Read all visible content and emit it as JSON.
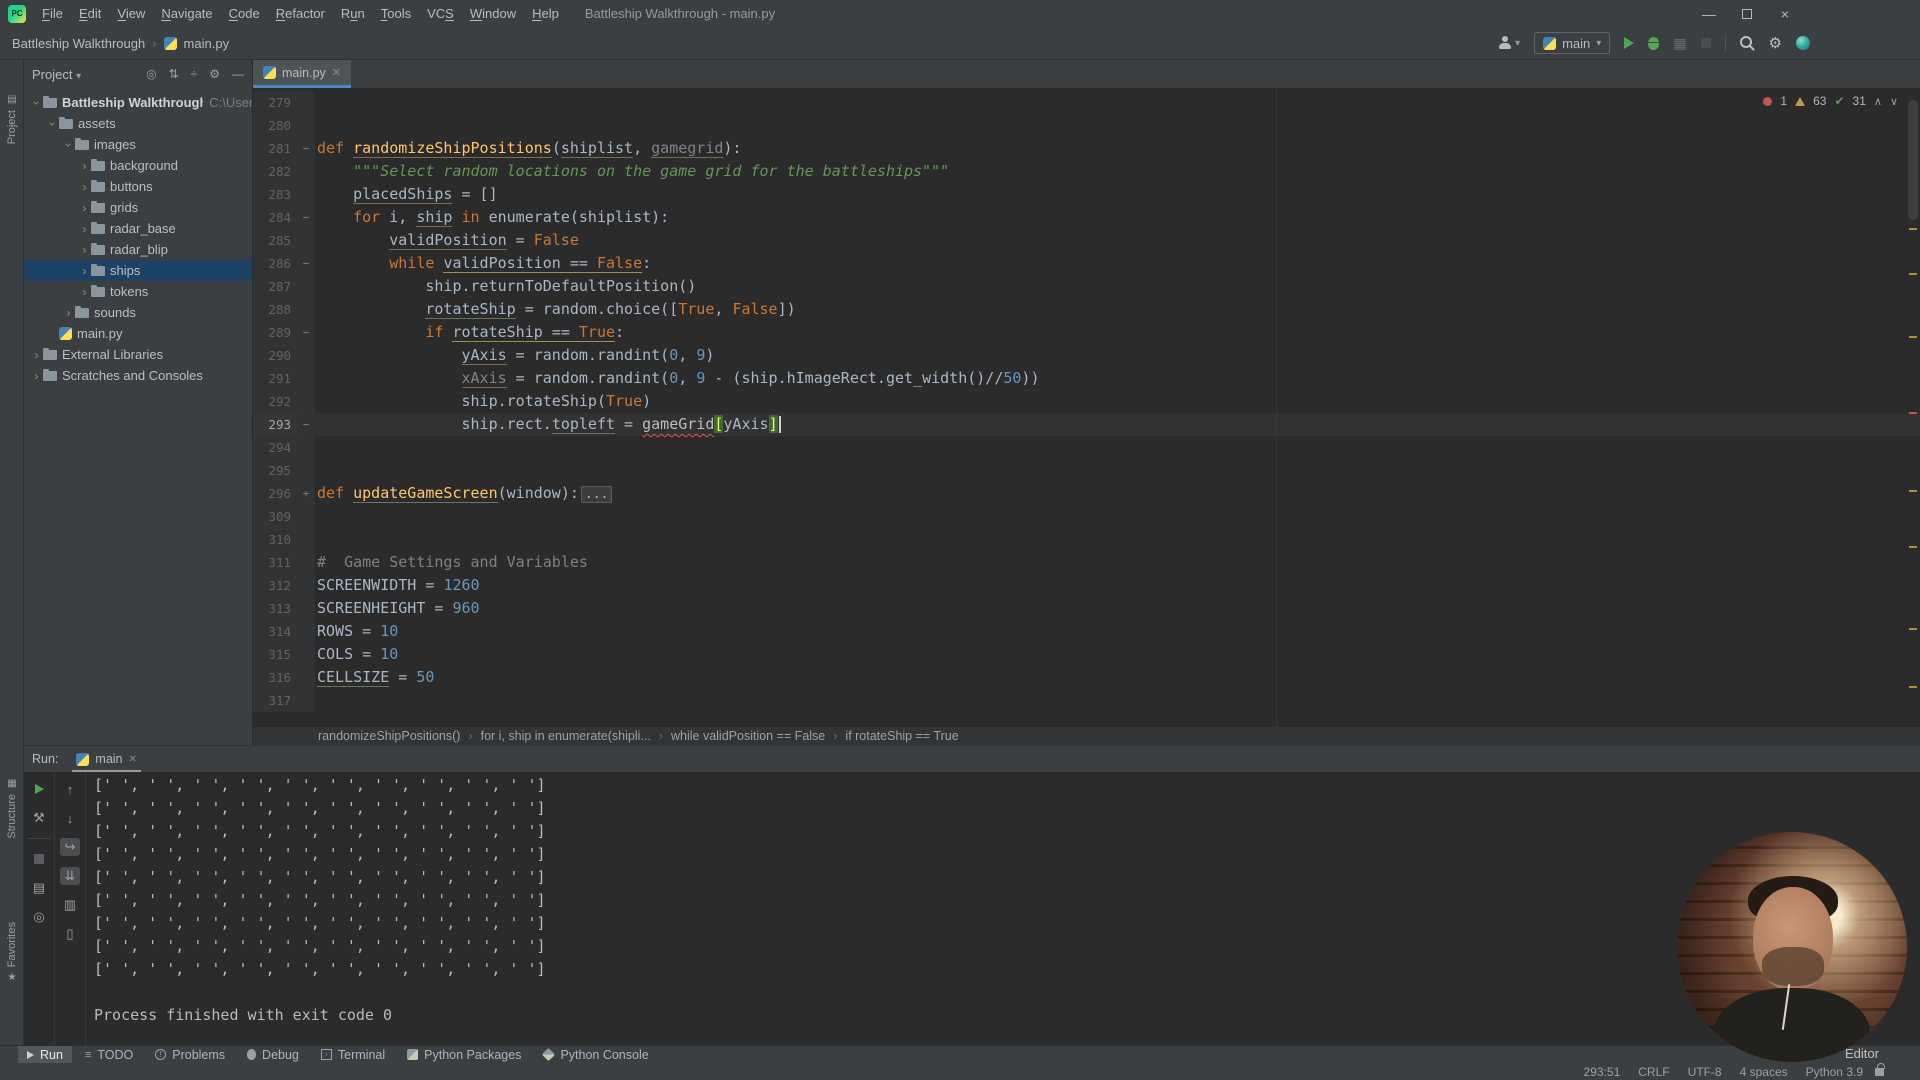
{
  "colors": {
    "accent_blue": "#4a88c7",
    "run_green": "#4fa84f",
    "error_red": "#c75450",
    "warning_yellow": "#b5a04c",
    "selection_blue": "#1d4266"
  },
  "title_bar": {
    "app_icon": "PC",
    "menus": [
      {
        "label": "File",
        "m": 0
      },
      {
        "label": "Edit",
        "m": 0
      },
      {
        "label": "View",
        "m": 0
      },
      {
        "label": "Navigate",
        "m": 0
      },
      {
        "label": "Code",
        "m": 0
      },
      {
        "label": "Refactor",
        "m": 0
      },
      {
        "label": "Run",
        "m": 1
      },
      {
        "label": "Tools",
        "m": 0
      },
      {
        "label": "VCS",
        "m": 2
      },
      {
        "label": "Window",
        "m": 0
      },
      {
        "label": "Help",
        "m": 0
      }
    ],
    "window_title": "Battleship Walkthrough - main.py"
  },
  "nav_bar": {
    "breadcrumbs": [
      "Battleship Walkthrough",
      "main.py"
    ],
    "run_config": "main"
  },
  "tool_strip": {
    "project": "Project",
    "structure": "Structure",
    "favorites": "Favorites"
  },
  "project_panel": {
    "title": "Project",
    "header_icons": [
      "locate-icon",
      "expand-collapse-icon",
      "collapse-all-icon",
      "settings-icon",
      "hide-icon"
    ],
    "tree": [
      {
        "label": "Battleship Walkthrough",
        "suffix": "C:\\User",
        "indent": 0,
        "chev": "open",
        "icon": "folder",
        "bold": true
      },
      {
        "label": "assets",
        "indent": 1,
        "chev": "open",
        "icon": "folder"
      },
      {
        "label": "images",
        "indent": 2,
        "chev": "open",
        "icon": "folder"
      },
      {
        "label": "background",
        "indent": 3,
        "chev": "closed",
        "icon": "folder"
      },
      {
        "label": "buttons",
        "indent": 3,
        "chev": "closed",
        "icon": "folder"
      },
      {
        "label": "grids",
        "indent": 3,
        "chev": "closed",
        "icon": "folder"
      },
      {
        "label": "radar_base",
        "indent": 3,
        "chev": "closed",
        "icon": "folder"
      },
      {
        "label": "radar_blip",
        "indent": 3,
        "chev": "closed",
        "icon": "folder"
      },
      {
        "label": "ships",
        "indent": 3,
        "chev": "closed",
        "icon": "folder",
        "sel": true
      },
      {
        "label": "tokens",
        "indent": 3,
        "chev": "closed",
        "icon": "folder"
      },
      {
        "label": "sounds",
        "indent": 2,
        "chev": "closed",
        "icon": "folder"
      },
      {
        "label": "main.py",
        "indent": 1,
        "chev": "none",
        "icon": "py"
      },
      {
        "label": "External Libraries",
        "indent": 0,
        "chev": "closed",
        "icon": "folder"
      },
      {
        "label": "Scratches and Consoles",
        "indent": 0,
        "chev": "closed",
        "icon": "folder"
      }
    ]
  },
  "editor": {
    "tab": "main.py",
    "inspections": {
      "errors": "1",
      "warnings": "63",
      "passed": "31"
    },
    "lines": [
      {
        "n": "279",
        "t": []
      },
      {
        "n": "280",
        "t": []
      },
      {
        "n": "281",
        "f": "m",
        "t": [
          [
            "k",
            "def "
          ],
          [
            "f u",
            "randomizeShipPositions"
          ],
          [
            "p",
            "("
          ],
          [
            "p u",
            "shiplist"
          ],
          [
            "p",
            ", "
          ],
          [
            "g u",
            "gamegrid"
          ],
          [
            "p",
            "):"
          ]
        ]
      },
      {
        "n": "282",
        "t": [
          [
            "s",
            "    \"\"\"Select random locations on the game grid for the battleships\"\"\""
          ]
        ]
      },
      {
        "n": "283",
        "t": [
          [
            "p",
            "    "
          ],
          [
            "p u",
            "placedShips"
          ],
          [
            "p",
            " = []"
          ]
        ]
      },
      {
        "n": "284",
        "f": "m",
        "t": [
          [
            "p",
            "    "
          ],
          [
            "k",
            "for"
          ],
          [
            "p",
            " i, "
          ],
          [
            "p u",
            "ship"
          ],
          [
            "p",
            " "
          ],
          [
            "k",
            "in"
          ],
          [
            "p",
            " enumerate(shiplist):"
          ]
        ]
      },
      {
        "n": "285",
        "t": [
          [
            "p",
            "        "
          ],
          [
            "p u",
            "validPosition"
          ],
          [
            "p",
            " = "
          ],
          [
            "k",
            "False"
          ]
        ]
      },
      {
        "n": "286",
        "f": "m",
        "t": [
          [
            "p",
            "        "
          ],
          [
            "k",
            "while"
          ],
          [
            "p",
            " "
          ],
          [
            "p w",
            "validPosition == "
          ],
          [
            "k w",
            "False"
          ],
          [
            "p",
            ":"
          ]
        ]
      },
      {
        "n": "287",
        "t": [
          [
            "p",
            "            ship.returnToDefaultPosition()"
          ]
        ]
      },
      {
        "n": "288",
        "t": [
          [
            "p",
            "            "
          ],
          [
            "p u",
            "rotateShip"
          ],
          [
            "p",
            " = random.choice(["
          ],
          [
            "k",
            "True"
          ],
          [
            "p",
            ", "
          ],
          [
            "k",
            "False"
          ],
          [
            "p",
            "])"
          ]
        ]
      },
      {
        "n": "289",
        "f": "m",
        "t": [
          [
            "p",
            "            "
          ],
          [
            "k",
            "if"
          ],
          [
            "p",
            " "
          ],
          [
            "p w",
            "rotateShip == "
          ],
          [
            "k w",
            "True"
          ],
          [
            "p",
            ":"
          ]
        ]
      },
      {
        "n": "290",
        "t": [
          [
            "p",
            "                "
          ],
          [
            "p u",
            "yAxis"
          ],
          [
            "p",
            " = random.randint("
          ],
          [
            "n",
            "0"
          ],
          [
            "p",
            ", "
          ],
          [
            "n",
            "9"
          ],
          [
            "p",
            ")"
          ]
        ]
      },
      {
        "n": "291",
        "t": [
          [
            "p",
            "                "
          ],
          [
            "g u",
            "xAxis"
          ],
          [
            "p",
            " = random.randint("
          ],
          [
            "n",
            "0"
          ],
          [
            "p",
            ", "
          ],
          [
            "n",
            "9"
          ],
          [
            "p",
            " - (ship.hImageRect.get_width()//"
          ],
          [
            "n",
            "50"
          ],
          [
            "p",
            "))"
          ]
        ]
      },
      {
        "n": "292",
        "t": [
          [
            "p",
            "                ship.rotateShip("
          ],
          [
            "k",
            "True"
          ],
          [
            "p",
            ")"
          ]
        ]
      },
      {
        "n": "293",
        "f": "m",
        "cur": true,
        "t": [
          [
            "p",
            "                ship.rect."
          ],
          [
            "p u",
            "topleft"
          ],
          [
            "p",
            " = "
          ],
          [
            "e",
            "gameGrid"
          ],
          [
            "m",
            "["
          ],
          [
            "p",
            "yAxis"
          ],
          [
            "m",
            "]"
          ],
          [
            "caret",
            ""
          ]
        ]
      },
      {
        "n": "294",
        "t": []
      },
      {
        "n": "295",
        "t": []
      },
      {
        "n": "296",
        "f": "p",
        "t": [
          [
            "k",
            "def "
          ],
          [
            "f u",
            "updateGameScreen"
          ],
          [
            "p",
            "(window):"
          ],
          [
            "fold",
            "..."
          ]
        ]
      },
      {
        "n": "309",
        "t": []
      },
      {
        "n": "310",
        "t": []
      },
      {
        "n": "311",
        "t": [
          [
            "c",
            "#  Game Settings and Variables"
          ]
        ]
      },
      {
        "n": "312",
        "t": [
          [
            "p",
            "SCREENWIDTH = "
          ],
          [
            "n",
            "1260"
          ]
        ]
      },
      {
        "n": "313",
        "t": [
          [
            "p",
            "SCREENHEIGHT = "
          ],
          [
            "n",
            "960"
          ]
        ]
      },
      {
        "n": "314",
        "t": [
          [
            "p",
            "ROWS = "
          ],
          [
            "n",
            "10"
          ]
        ]
      },
      {
        "n": "315",
        "t": [
          [
            "p",
            "COLS = "
          ],
          [
            "n",
            "10"
          ]
        ]
      },
      {
        "n": "316",
        "t": [
          [
            "p u",
            "CELLSIZE"
          ],
          [
            "p",
            " = "
          ],
          [
            "n",
            "50"
          ]
        ]
      },
      {
        "n": "317",
        "t": []
      }
    ],
    "context_crumbs": [
      "randomizeShipPositions()",
      "for i, ship in enumerate(shipli...",
      "while validPosition == False",
      "if rotateShip == True"
    ]
  },
  "run_panel": {
    "label": "Run:",
    "tab": "main",
    "output_rows": [
      "[' ', ' ', ' ', ' ', ' ', ' ', ' ', ' ', ' ', ' ']",
      "[' ', ' ', ' ', ' ', ' ', ' ', ' ', ' ', ' ', ' ']",
      "[' ', ' ', ' ', ' ', ' ', ' ', ' ', ' ', ' ', ' ']",
      "[' ', ' ', ' ', ' ', ' ', ' ', ' ', ' ', ' ', ' ']",
      "[' ', ' ', ' ', ' ', ' ', ' ', ' ', ' ', ' ', ' ']",
      "[' ', ' ', ' ', ' ', ' ', ' ', ' ', ' ', ' ', ' ']",
      "[' ', ' ', ' ', ' ', ' ', ' ', ' ', ' ', ' ', ' ']",
      "[' ', ' ', ' ', ' ', ' ', ' ', ' ', ' ', ' ', ' ']",
      "[' ', ' ', ' ', ' ', ' ', ' ', ' ', ' ', ' ', ' ']"
    ],
    "exit_message": "Process finished with exit code 0"
  },
  "bottom_bar": {
    "items": [
      {
        "label": "Run",
        "icon": "play",
        "active": true
      },
      {
        "label": "TODO",
        "icon": "list"
      },
      {
        "label": "Problems",
        "icon": "problem"
      },
      {
        "label": "Debug",
        "icon": "bug"
      },
      {
        "label": "Terminal",
        "icon": "term"
      },
      {
        "label": "Python Packages",
        "icon": "pybox"
      },
      {
        "label": "Python Console",
        "icon": "pydiamond"
      }
    ]
  },
  "status_bar": {
    "items": [
      "293:51",
      "CRLF",
      "UTF-8",
      "4 spaces",
      "Python 3.9"
    ]
  },
  "watermark": "Editor"
}
